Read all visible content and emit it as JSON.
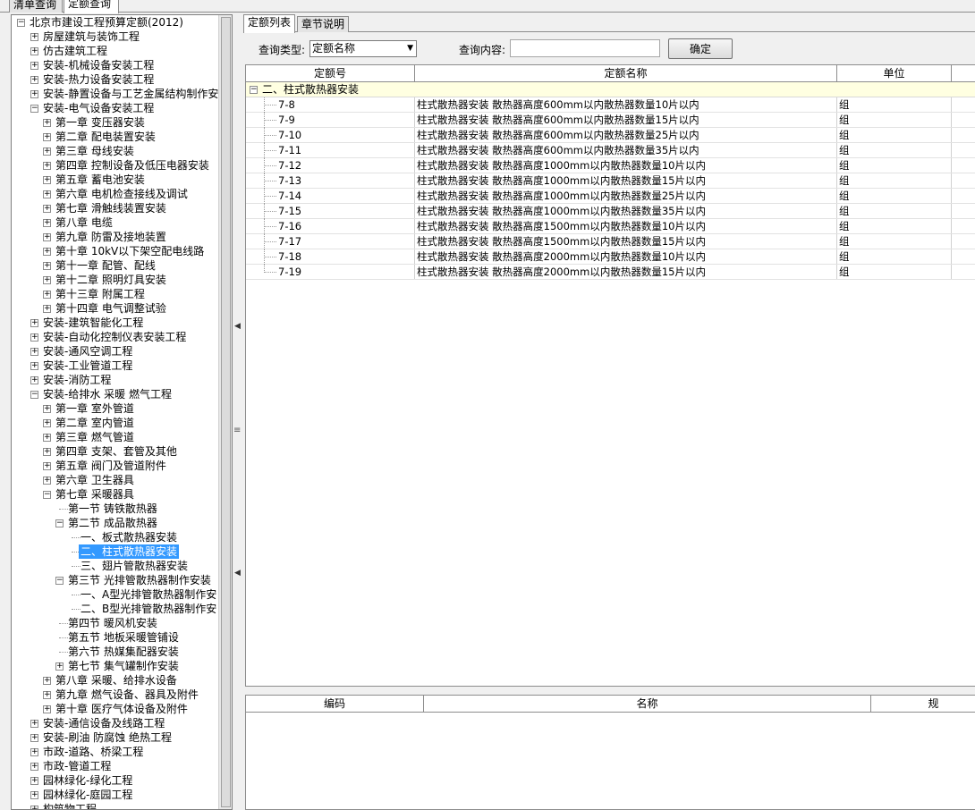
{
  "top_tabs": [
    "清单查询",
    "定额查询"
  ],
  "tree": {
    "items": [
      {
        "label": "北京市建设工程预算定额(2012)",
        "level": 0,
        "exp": "minus"
      },
      {
        "label": "房屋建筑与装饰工程",
        "level": 1,
        "exp": "plus"
      },
      {
        "label": "仿古建筑工程",
        "level": 1,
        "exp": "plus"
      },
      {
        "label": "安装-机械设备安装工程",
        "level": 1,
        "exp": "plus"
      },
      {
        "label": "安装-热力设备安装工程",
        "level": 1,
        "exp": "plus"
      },
      {
        "label": "安装-静置设备与工艺金属结构制作安",
        "level": 1,
        "exp": "plus"
      },
      {
        "label": "安装-电气设备安装工程",
        "level": 1,
        "exp": "minus"
      },
      {
        "label": "第一章 变压器安装",
        "level": 2,
        "exp": "plus"
      },
      {
        "label": "第二章 配电装置安装",
        "level": 2,
        "exp": "plus"
      },
      {
        "label": "第三章 母线安装",
        "level": 2,
        "exp": "plus"
      },
      {
        "label": "第四章 控制设备及低压电器安装",
        "level": 2,
        "exp": "plus"
      },
      {
        "label": "第五章 蓄电池安装",
        "level": 2,
        "exp": "plus"
      },
      {
        "label": "第六章 电机检查接线及调试",
        "level": 2,
        "exp": "plus"
      },
      {
        "label": "第七章 滑触线装置安装",
        "level": 2,
        "exp": "plus"
      },
      {
        "label": "第八章 电缆",
        "level": 2,
        "exp": "plus"
      },
      {
        "label": "第九章 防雷及接地装置",
        "level": 2,
        "exp": "plus"
      },
      {
        "label": "第十章 10kV以下架空配电线路",
        "level": 2,
        "exp": "plus"
      },
      {
        "label": "第十一章 配管、配线",
        "level": 2,
        "exp": "plus"
      },
      {
        "label": "第十二章 照明灯具安装",
        "level": 2,
        "exp": "plus"
      },
      {
        "label": "第十三章 附属工程",
        "level": 2,
        "exp": "plus"
      },
      {
        "label": "第十四章 电气调整试验",
        "level": 2,
        "exp": "plus"
      },
      {
        "label": "安装-建筑智能化工程",
        "level": 1,
        "exp": "plus"
      },
      {
        "label": "安装-自动化控制仪表安装工程",
        "level": 1,
        "exp": "plus"
      },
      {
        "label": "安装-通风空调工程",
        "level": 1,
        "exp": "plus"
      },
      {
        "label": "安装-工业管道工程",
        "level": 1,
        "exp": "plus"
      },
      {
        "label": "安装-消防工程",
        "level": 1,
        "exp": "plus"
      },
      {
        "label": "安装-给排水 采暖 燃气工程",
        "level": 1,
        "exp": "minus"
      },
      {
        "label": "第一章 室外管道",
        "level": 2,
        "exp": "plus"
      },
      {
        "label": "第二章 室内管道",
        "level": 2,
        "exp": "plus"
      },
      {
        "label": "第三章 燃气管道",
        "level": 2,
        "exp": "plus"
      },
      {
        "label": "第四章 支架、套管及其他",
        "level": 2,
        "exp": "plus"
      },
      {
        "label": "第五章 阀门及管道附件",
        "level": 2,
        "exp": "plus"
      },
      {
        "label": "第六章 卫生器具",
        "level": 2,
        "exp": "plus"
      },
      {
        "label": "第七章 采暖器具",
        "level": 2,
        "exp": "minus"
      },
      {
        "label": "第一节 铸铁散热器",
        "level": 3,
        "exp": "none"
      },
      {
        "label": "第二节 成品散热器",
        "level": 3,
        "exp": "minus"
      },
      {
        "label": "一、板式散热器安装",
        "level": 4,
        "exp": "none"
      },
      {
        "label": "二、柱式散热器安装",
        "level": 4,
        "exp": "none",
        "selected": true
      },
      {
        "label": "三、翅片管散热器安装",
        "level": 4,
        "exp": "none"
      },
      {
        "label": "第三节 光排管散热器制作安装",
        "level": 3,
        "exp": "minus"
      },
      {
        "label": "一、A型光排管散热器制作安",
        "level": 4,
        "exp": "none"
      },
      {
        "label": "二、B型光排管散热器制作安",
        "level": 4,
        "exp": "none"
      },
      {
        "label": "第四节 暖风机安装",
        "level": 3,
        "exp": "none"
      },
      {
        "label": "第五节 地板采暖管铺设",
        "level": 3,
        "exp": "none"
      },
      {
        "label": "第六节 热媒集配器安装",
        "level": 3,
        "exp": "none"
      },
      {
        "label": "第七节 集气罐制作安装",
        "level": 3,
        "exp": "plus"
      },
      {
        "label": "第八章 采暖、给排水设备",
        "level": 2,
        "exp": "plus"
      },
      {
        "label": "第九章 燃气设备、器具及附件",
        "level": 2,
        "exp": "plus"
      },
      {
        "label": "第十章 医疗气体设备及附件",
        "level": 2,
        "exp": "plus"
      },
      {
        "label": "安装-通信设备及线路工程",
        "level": 1,
        "exp": "plus"
      },
      {
        "label": "安装-刷油 防腐蚀 绝热工程",
        "level": 1,
        "exp": "plus"
      },
      {
        "label": "市政-道路、桥梁工程",
        "level": 1,
        "exp": "plus"
      },
      {
        "label": "市政-管道工程",
        "level": 1,
        "exp": "plus"
      },
      {
        "label": "园林绿化-绿化工程",
        "level": 1,
        "exp": "plus"
      },
      {
        "label": "园林绿化-庭园工程",
        "level": 1,
        "exp": "plus"
      },
      {
        "label": "构筑物工程",
        "level": 1,
        "exp": "plus"
      }
    ]
  },
  "right_tabs": [
    "定额列表",
    "章节说明"
  ],
  "query": {
    "type_label": "查询类型:",
    "type_value": "定额名称",
    "content_label": "查询内容:",
    "content_value": "",
    "confirm_label": "确定"
  },
  "grid": {
    "headers": [
      "定额号",
      "定额名称",
      "单位"
    ],
    "group_label": "二、柱式散热器安装",
    "rows": [
      {
        "code": "7-8",
        "name": "柱式散热器安装 散热器高度600mm以内散热器数量10片以内",
        "unit": "组"
      },
      {
        "code": "7-9",
        "name": "柱式散热器安装 散热器高度600mm以内散热器数量15片以内",
        "unit": "组"
      },
      {
        "code": "7-10",
        "name": "柱式散热器安装 散热器高度600mm以内散热器数量25片以内",
        "unit": "组"
      },
      {
        "code": "7-11",
        "name": "柱式散热器安装 散热器高度600mm以内散热器数量35片以内",
        "unit": "组"
      },
      {
        "code": "7-12",
        "name": "柱式散热器安装 散热器高度1000mm以内散热器数量10片以内",
        "unit": "组"
      },
      {
        "code": "7-13",
        "name": "柱式散热器安装 散热器高度1000mm以内散热器数量15片以内",
        "unit": "组"
      },
      {
        "code": "7-14",
        "name": "柱式散热器安装 散热器高度1000mm以内散热器数量25片以内",
        "unit": "组"
      },
      {
        "code": "7-15",
        "name": "柱式散热器安装 散热器高度1000mm以内散热器数量35片以内",
        "unit": "组"
      },
      {
        "code": "7-16",
        "name": "柱式散热器安装 散热器高度1500mm以内散热器数量10片以内",
        "unit": "组"
      },
      {
        "code": "7-17",
        "name": "柱式散热器安装 散热器高度1500mm以内散热器数量15片以内",
        "unit": "组"
      },
      {
        "code": "7-18",
        "name": "柱式散热器安装 散热器高度2000mm以内散热器数量10片以内",
        "unit": "组"
      },
      {
        "code": "7-19",
        "name": "柱式散热器安装 散热器高度2000mm以内散热器数量15片以内",
        "unit": "组"
      }
    ]
  },
  "grid2": {
    "headers": [
      "编码",
      "名称",
      "规"
    ]
  }
}
